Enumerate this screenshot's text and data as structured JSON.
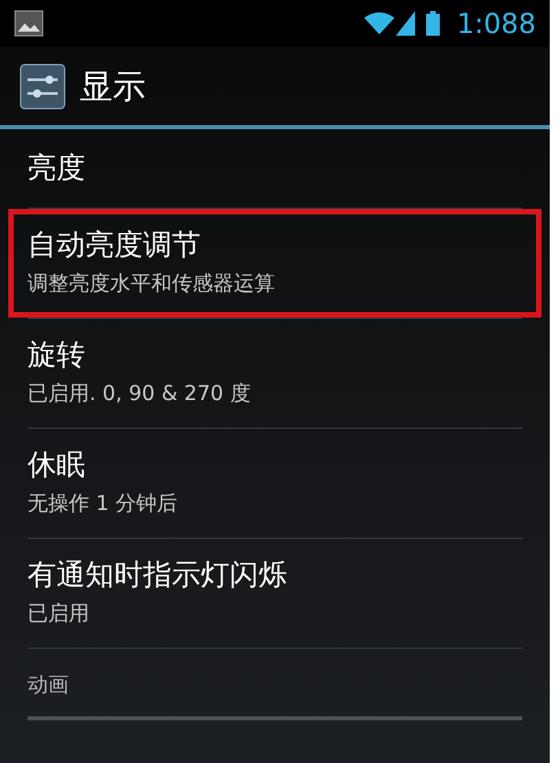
{
  "status_bar": {
    "time": "1:088"
  },
  "action_bar": {
    "title": "显示"
  },
  "items": [
    {
      "kind": "setting",
      "title": "亮度",
      "highlighted": false
    },
    {
      "kind": "setting",
      "title": "自动亮度调节",
      "summary": "调整亮度水平和传感器运算",
      "highlighted": true
    },
    {
      "kind": "setting",
      "title": "旋转",
      "summary": "已启用. 0, 90 & 270 度",
      "highlighted": false
    },
    {
      "kind": "setting",
      "title": "休眠",
      "summary": "无操作 1 分钟后",
      "highlighted": false
    },
    {
      "kind": "setting",
      "title": "有通知时指示灯闪烁",
      "summary": "已启用",
      "highlighted": false
    },
    {
      "kind": "category",
      "title": "动画"
    }
  ]
}
